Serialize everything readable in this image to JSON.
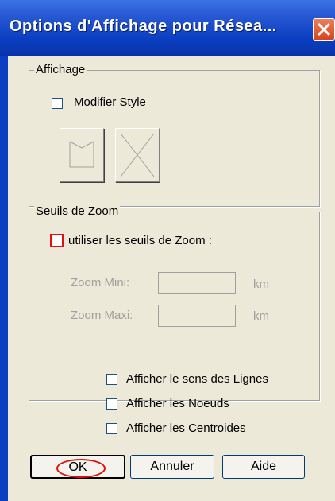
{
  "window": {
    "title": "Options d'Affichage pour Résea..."
  },
  "affichage": {
    "group_label": "Affichage",
    "modifier_style_label": "Modifier Style",
    "modifier_style_checked": false
  },
  "zoom": {
    "group_label": "Seuils de Zoom",
    "use_thresholds_label": "utiliser les seuils de Zoom :",
    "use_thresholds_checked": false,
    "min_label": "Zoom Mini:",
    "min_value": "",
    "min_unit": "km",
    "max_label": "Zoom Maxi:",
    "max_value": "",
    "max_unit": "km"
  },
  "display_options": [
    {
      "label": "Afficher le sens des Lignes",
      "checked": false
    },
    {
      "label": "Afficher les Noeuds",
      "checked": false
    },
    {
      "label": "Afficher les Centroides",
      "checked": false
    }
  ],
  "buttons": {
    "ok": "OK",
    "cancel": "Annuler",
    "help": "Aide"
  },
  "colors": {
    "titlebar": "#0a3fc1",
    "highlight": "#e01010"
  }
}
